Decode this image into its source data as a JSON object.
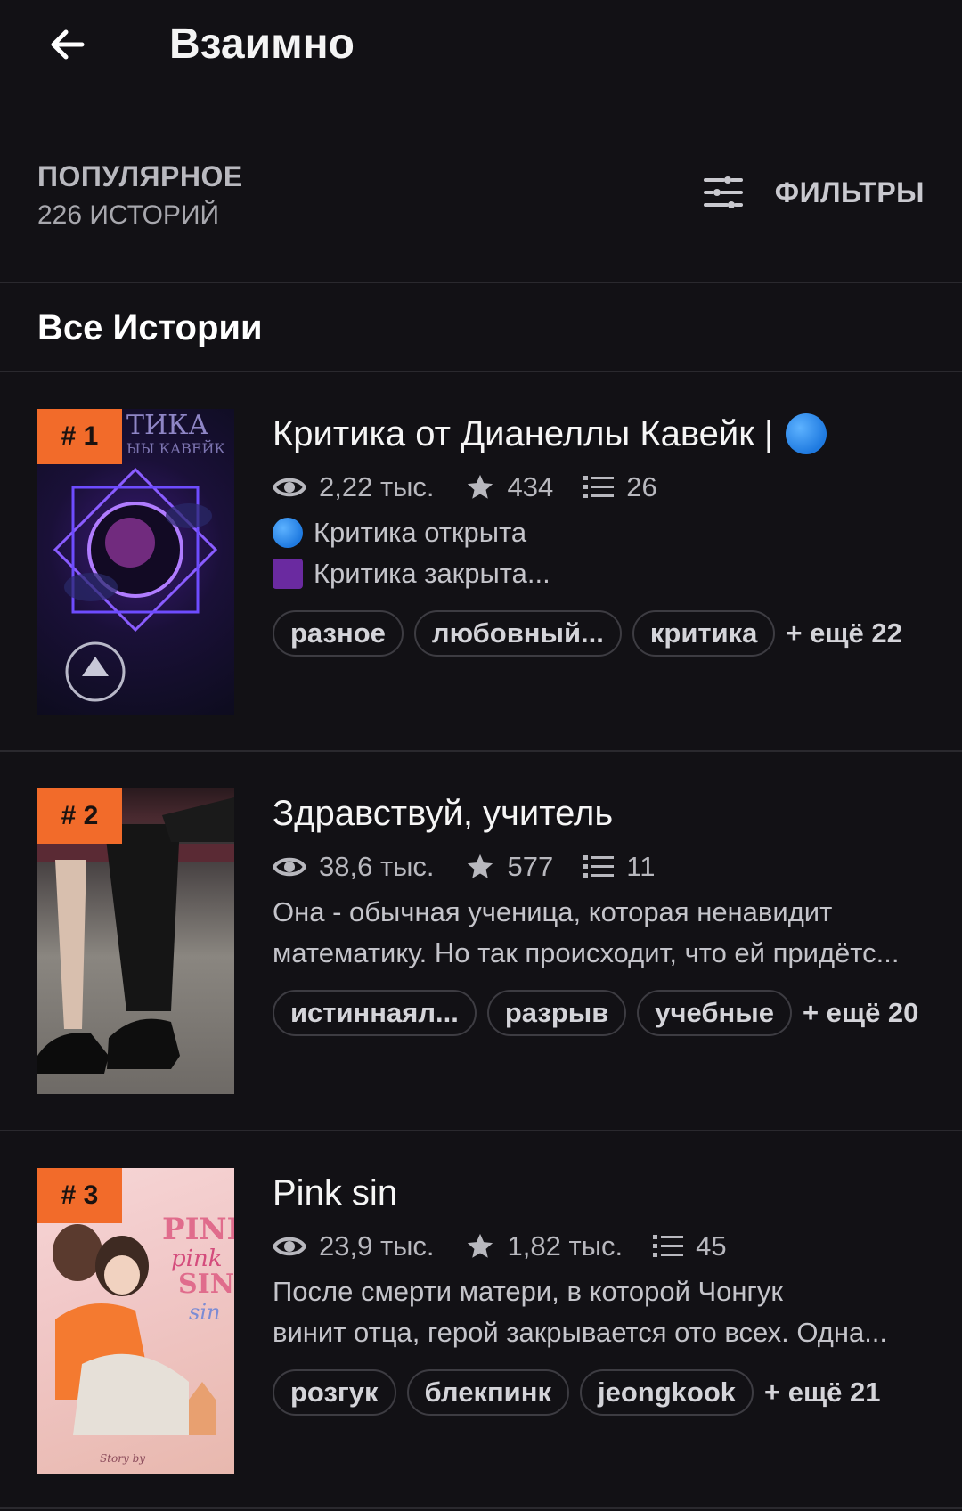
{
  "header": {
    "title": "Взаимно"
  },
  "sort": {
    "label": "ПОПУЛЯРНОЕ",
    "count": "226 ИСТОРИЙ"
  },
  "filters": {
    "label": "ФИЛЬТРЫ"
  },
  "section_title": "Все Истории",
  "stories": [
    {
      "rank": "# 1",
      "title": "Критика от Дианеллы Кавейк  |",
      "reads": "2,22 тыс.",
      "votes": "434",
      "parts": "26",
      "desc_lines": [
        "Критика открыта",
        "Критика закрыта..."
      ],
      "tags": [
        "разное",
        "любовный...",
        "критика"
      ],
      "more": "+ ещё 22",
      "cover_text": "ТИКА\nЫЫ КАВЕЙК"
    },
    {
      "rank": "# 2",
      "title": "Здравствуй, учитель",
      "reads": "38,6 тыс.",
      "votes": "577",
      "parts": "11",
      "desc_lines": [
        "Она - обычная ученица, которая ненавидит",
        "математику. Но так происходит, что ей придётс..."
      ],
      "tags": [
        "истиннаял...",
        "разрыв",
        "учебные"
      ],
      "more": "+ ещё 20"
    },
    {
      "rank": "# 3",
      "title": "Pink sin",
      "reads": "23,9 тыс.",
      "votes": "1,82 тыс.",
      "parts": "45",
      "desc_lines": [
        "После смерти матери, в которой Чонгук",
        "винит отца, герой закрывается ото всех. Одна..."
      ],
      "tags": [
        "розгук",
        "блекпинк",
        "jeongkook"
      ],
      "more": "+ ещё 21",
      "cover_text": "PINK pink SIN sin"
    }
  ],
  "colors": {
    "background": "#121115",
    "rank_badge": "#f26b2a",
    "divider": "#2a292e"
  }
}
